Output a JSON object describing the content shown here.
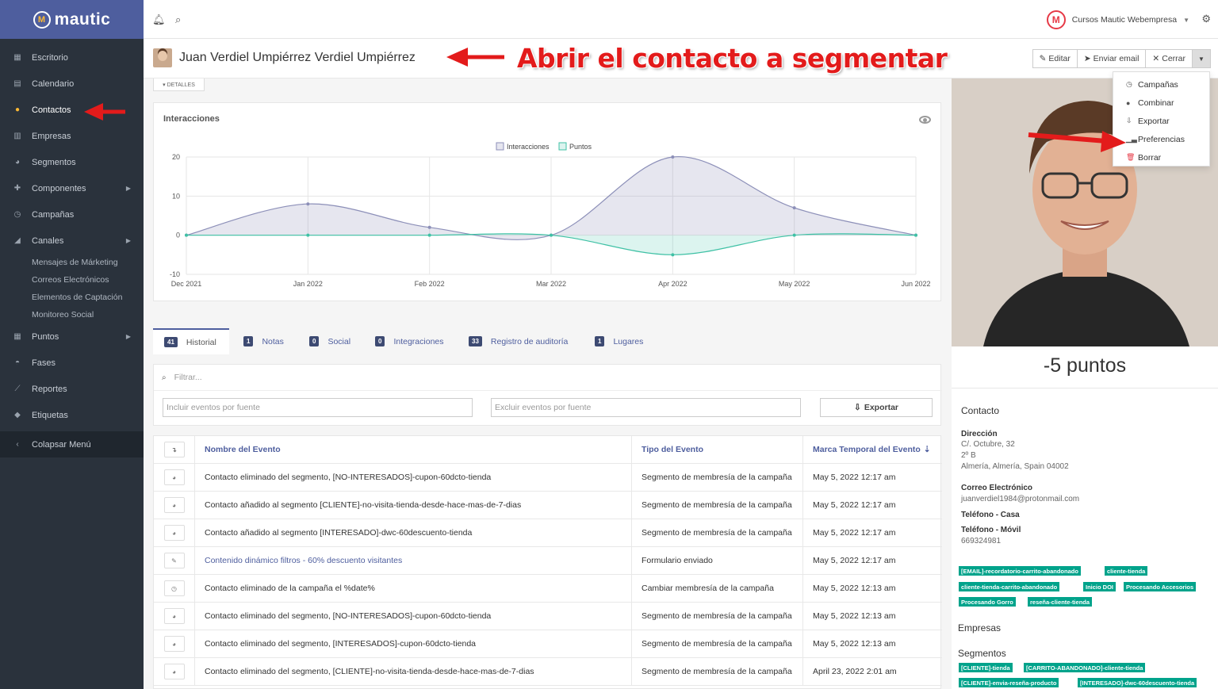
{
  "brand": {
    "name": "mautic"
  },
  "sidebar": {
    "items": [
      {
        "label": "Escritorio",
        "icon": "grid-icon"
      },
      {
        "label": "Calendario",
        "icon": "calendar-icon"
      },
      {
        "label": "Contactos",
        "icon": "user-icon"
      },
      {
        "label": "Empresas",
        "icon": "building-icon"
      },
      {
        "label": "Segmentos",
        "icon": "pie-chart-icon"
      },
      {
        "label": "Componentes",
        "icon": "puzzle-icon"
      },
      {
        "label": "Campañas",
        "icon": "clock-icon"
      },
      {
        "label": "Canales",
        "icon": "rss-icon"
      }
    ],
    "sub_items": [
      "Mensajes de Márketing",
      "Correos Electrónicos",
      "Elementos de Captación",
      "Monitoreo Social"
    ],
    "items2": [
      {
        "label": "Puntos",
        "icon": "calculator-icon"
      },
      {
        "label": "Fases",
        "icon": "tachometer-icon"
      },
      {
        "label": "Reportes",
        "icon": "line-chart-icon"
      },
      {
        "label": "Etiquetas",
        "icon": "tag-icon"
      }
    ],
    "collapse_label": "Colapsar Menú"
  },
  "topbar": {
    "org_name": "Cursos Mautic Webempresa",
    "org_initial": "M"
  },
  "header": {
    "contact_name": "Juan Verdiel Umpiérrez Verdiel Umpiérrez",
    "annotation": "Abrir el contacto a segmentar",
    "edit_label": "Editar",
    "email_label": "Enviar email",
    "close_label": "Cerrar",
    "details_label": "▾ DETALLES"
  },
  "dropdown": [
    "Campañas",
    "Combinar",
    "Exportar",
    "Preferencias",
    "Borrar"
  ],
  "chart_data": {
    "type": "area",
    "title": "Interacciones",
    "x": [
      "Dec 2021",
      "Jan 2022",
      "Feb 2022",
      "Mar 2022",
      "Apr 2022",
      "May 2022",
      "Jun 2022"
    ],
    "series": [
      {
        "name": "Interacciones",
        "values": [
          0,
          8,
          2,
          0,
          20,
          7,
          0
        ]
      },
      {
        "name": "Puntos",
        "values": [
          0,
          0,
          0,
          0,
          -5,
          0,
          0
        ]
      }
    ],
    "ylim": [
      -10,
      20
    ],
    "yticks": [
      20,
      10,
      0,
      -10
    ],
    "grid": true,
    "legend": "top-center",
    "colors": {
      "interacciones": "#8c8fb8",
      "puntos": "#3fc1a5"
    }
  },
  "tabs": [
    {
      "count": "41",
      "label": "Historial"
    },
    {
      "count": "1",
      "label": "Notas"
    },
    {
      "count": "0",
      "label": "Social"
    },
    {
      "count": "0",
      "label": "Integraciones"
    },
    {
      "count": "33",
      "label": "Registro de auditoría"
    },
    {
      "count": "1",
      "label": "Lugares"
    }
  ],
  "filter": {
    "search_placeholder": "Filtrar...",
    "include_placeholder": "Incluir eventos por fuente",
    "exclude_placeholder": "Excluir eventos por fuente",
    "export_label": "Exportar"
  },
  "table": {
    "headers": [
      "Nombre del Evento",
      "Tipo del Evento",
      "Marca Temporal del Evento"
    ],
    "rows": [
      {
        "name": "Contacto eliminado del segmento, [NO-INTERESADOS]-cupon-60dcto-tienda",
        "type": "Segmento de membresía de la campaña",
        "time": "May 5, 2022 12:17 am"
      },
      {
        "name": "Contacto añadido al segmento [CLIENTE]-no-visita-tienda-desde-hace-mas-de-7-dias",
        "type": "Segmento de membresía de la campaña",
        "time": "May 5, 2022 12:17 am"
      },
      {
        "name": "Contacto añadido al segmento [INTERESADO]-dwc-60descuento-tienda",
        "type": "Segmento de membresía de la campaña",
        "time": "May 5, 2022 12:17 am"
      },
      {
        "name": "Contenido dinámico filtros - 60% descuento visitantes",
        "type": "Formulario enviado",
        "time": "May 5, 2022 12:17 am"
      },
      {
        "name": "Contacto eliminado de la campaña el %date%",
        "type": "Cambiar membresía de la campaña",
        "time": "May 5, 2022 12:13 am"
      },
      {
        "name": "Contacto eliminado del segmento, [NO-INTERESADOS]-cupon-60dcto-tienda",
        "type": "Segmento de membresía de la campaña",
        "time": "May 5, 2022 12:13 am"
      },
      {
        "name": "Contacto eliminado del segmento, [INTERESADOS]-cupon-60dcto-tienda",
        "type": "Segmento de membresía de la campaña",
        "time": "May 5, 2022 12:13 am"
      },
      {
        "name": "Contacto eliminado del segmento, [CLIENTE]-no-visita-tienda-desde-hace-mas-de-7-dias",
        "type": "Segmento de membresía de la campaña",
        "time": "April 23, 2022 2:01 am"
      }
    ]
  },
  "profile": {
    "points": "-5 puntos",
    "contact_title": "Contacto",
    "address_label": "Dirección",
    "address_1": "C/. Octubre, 32",
    "address_2": "2º B",
    "address_3": "Almería, Almería, Spain 04002",
    "email_label": "Correo Electrónico",
    "email": "juanverdiel1984@protonmail.com",
    "phone_home_label": "Teléfono - Casa",
    "phone_mobile_label": "Teléfono - Móvil",
    "phone_mobile": "669324981",
    "tags": [
      "[EMAIL]-recordatorio-carrito-abandonado",
      "cliente-tienda",
      "cliente-tienda-carrito-abandonado",
      "Inicio DOI",
      "Procesando Accesorios",
      "Procesando Gorro",
      "reseña-cliente-tienda"
    ],
    "companies_title": "Empresas",
    "segments_title": "Segmentos",
    "segments": [
      "[CLIENTE]-tienda",
      "[CARRITO-ABANDONADO]-cliente-tienda",
      "[CLIENTE]-envia-reseña-producto",
      "[INTERESADO]-dwc-60descuento-tienda"
    ]
  }
}
